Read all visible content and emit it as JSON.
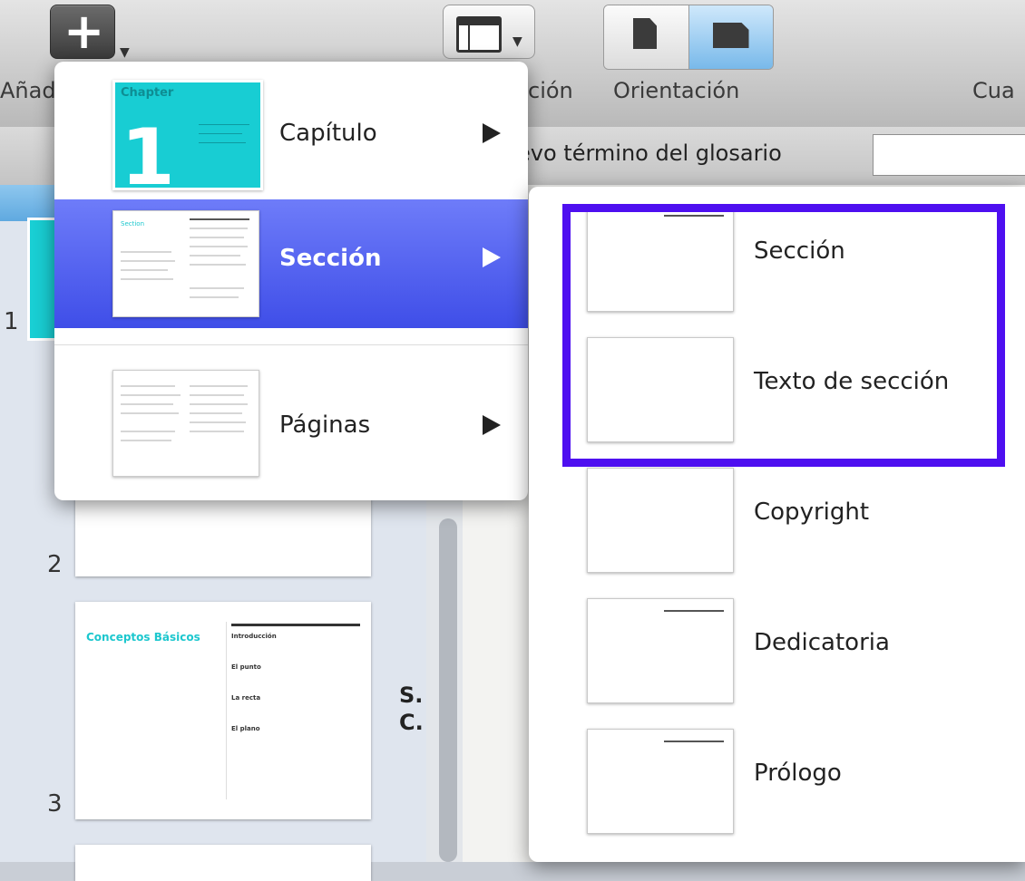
{
  "toolbar": {
    "add_label": "Añad",
    "view_label": "ción",
    "orientation_label": "Orientación",
    "right_label": "Cua"
  },
  "glossary": {
    "label": "evo término del glosario",
    "input_value": ""
  },
  "sidebar": {
    "page_numbers": [
      "1",
      "2",
      "3"
    ],
    "thumb3": {
      "title": "Conceptos Básicos",
      "side_items": [
        "Introducción",
        "El punto",
        "La recta",
        "El plano"
      ]
    },
    "side_note": [
      "S.",
      "C."
    ]
  },
  "menu": {
    "items": [
      {
        "label": "Capítulo",
        "thumb": "Chapter",
        "thumb_number": "1"
      },
      {
        "label": "Sección",
        "thumb_title": "Section"
      },
      {
        "label": "Páginas"
      }
    ]
  },
  "submenu": {
    "items": [
      {
        "label": "Sección"
      },
      {
        "label": "Texto de sección"
      },
      {
        "label": "Copyright"
      },
      {
        "label": "Dedicatoria"
      },
      {
        "label": "Prólogo"
      }
    ]
  },
  "colors": {
    "highlight": "#4e0ff0",
    "selected_row": "#4f5cf0",
    "chapter_accent": "#18cdd3"
  }
}
